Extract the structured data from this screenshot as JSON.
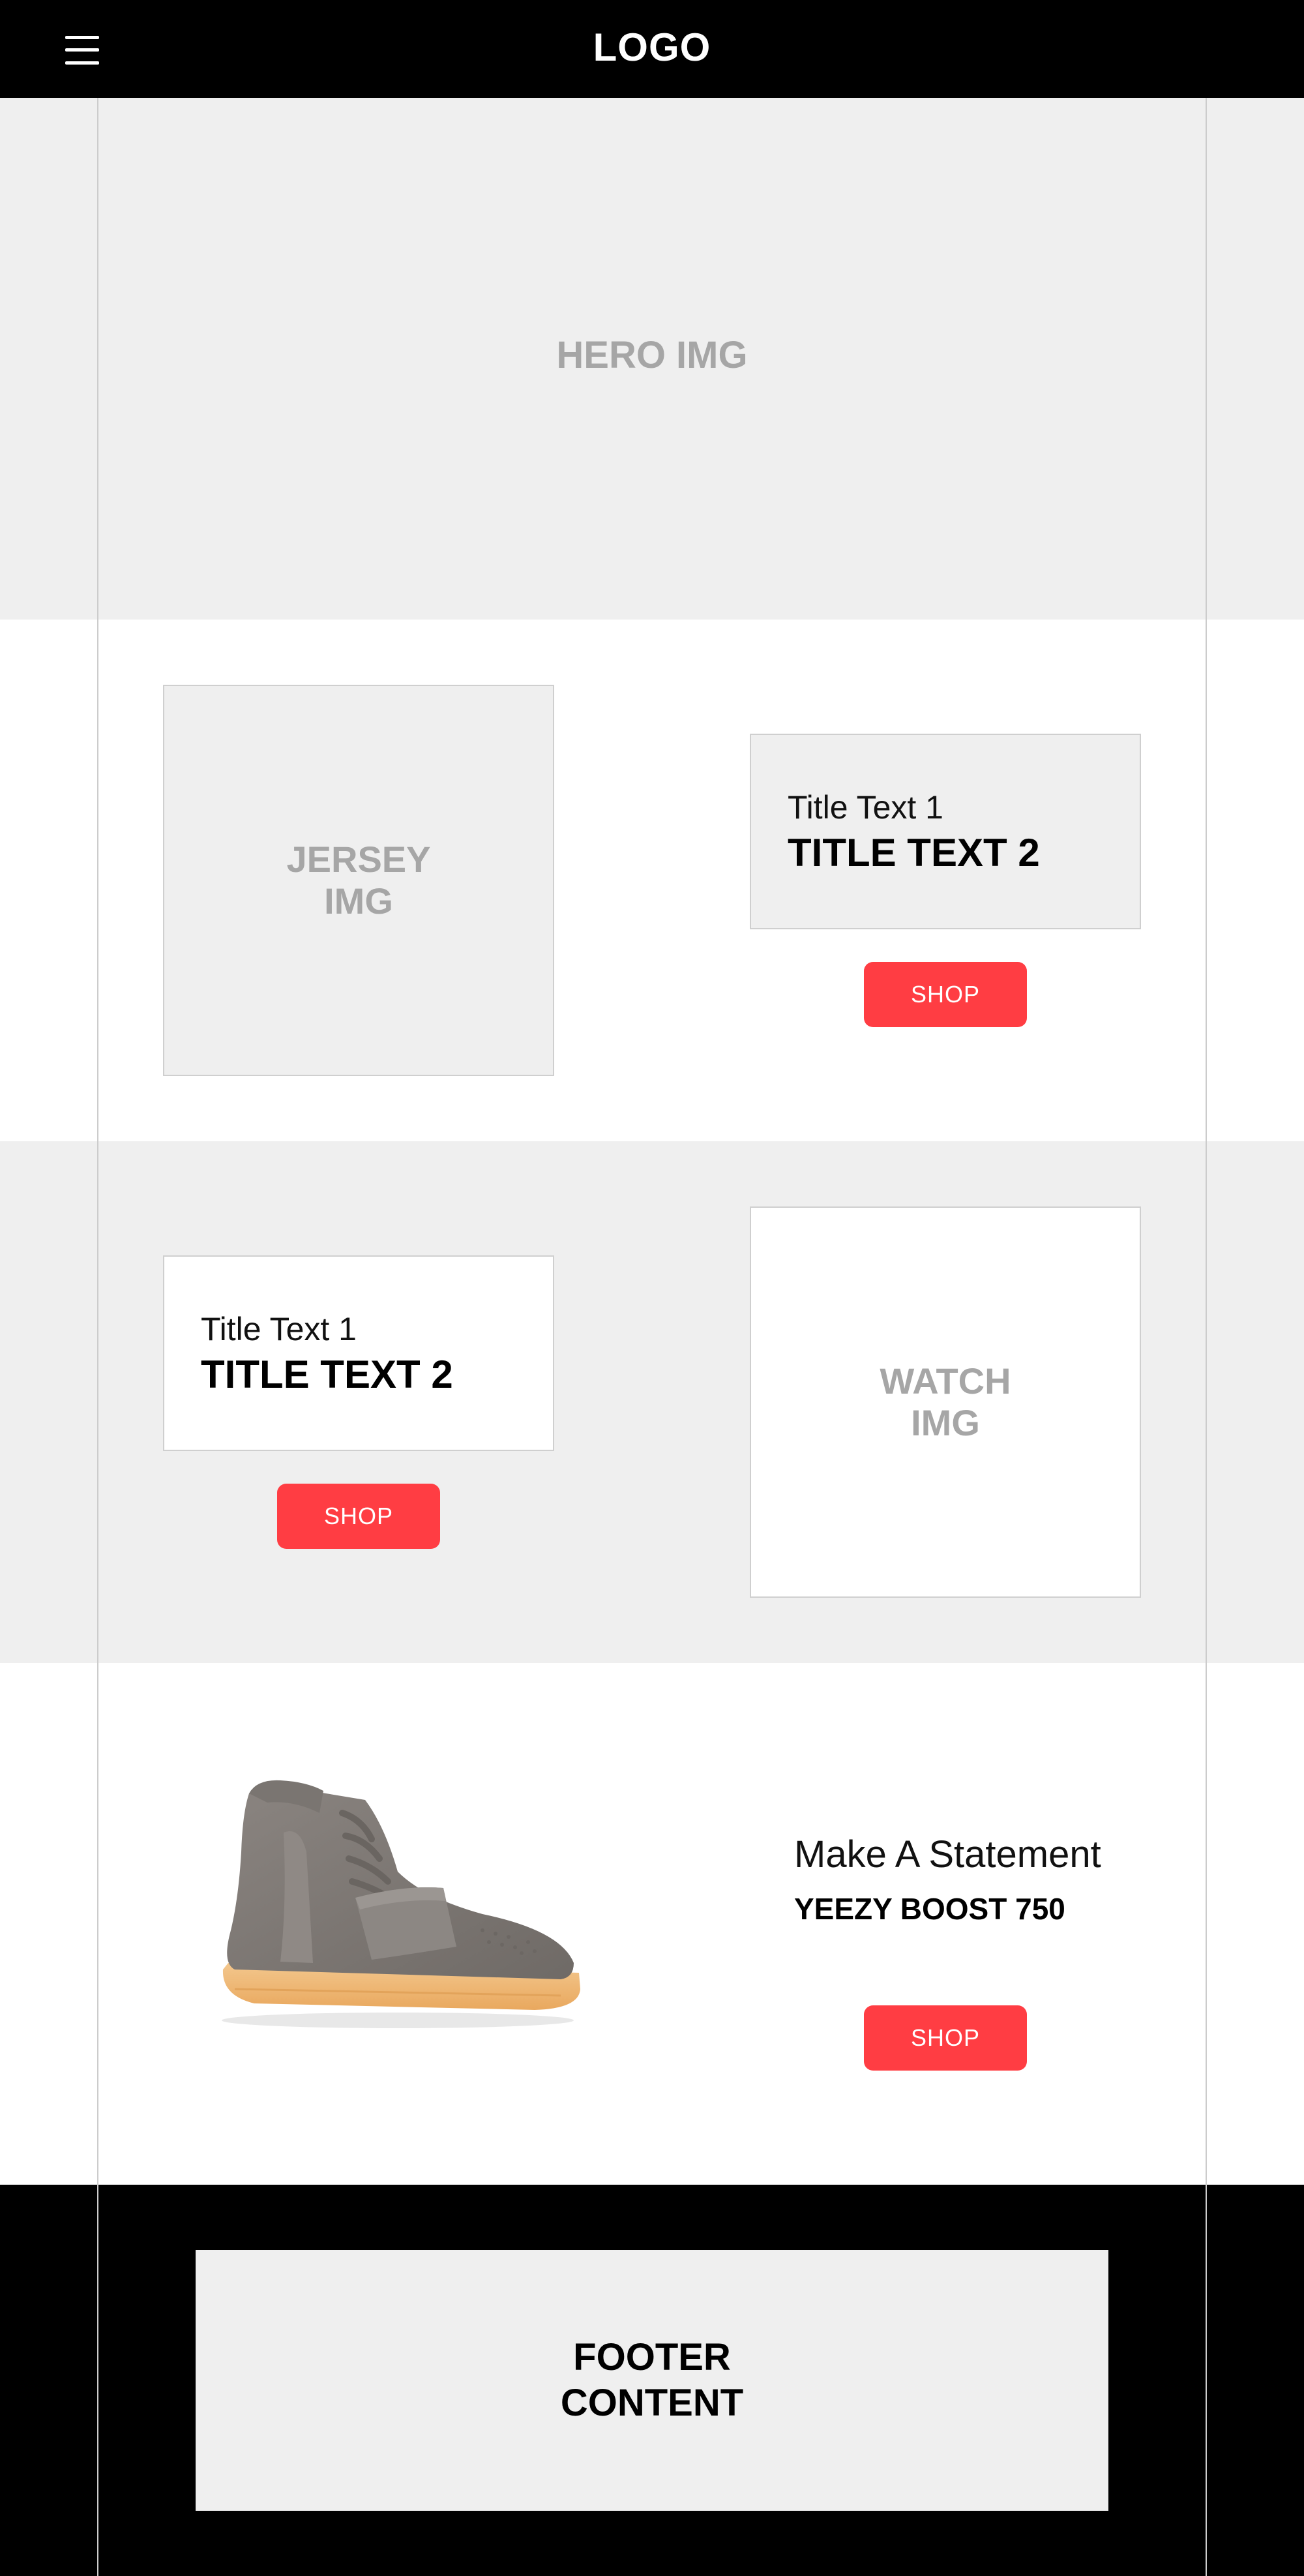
{
  "header": {
    "logo": "LOGO",
    "menu_icon": "hamburger-menu-icon"
  },
  "hero": {
    "label": "HERO IMG"
  },
  "section_1": {
    "image_label": "JERSEY IMG",
    "title_1": "Title Text 1",
    "title_2": "TITLE TEXT 2",
    "button_label": "SHOP"
  },
  "section_2": {
    "title_1": "Title Text 1",
    "title_2": "TITLE TEXT 2",
    "button_label": "SHOP",
    "image_label": "WATCH IMG"
  },
  "section_3": {
    "tagline": "Make A Statement",
    "product_name": "YEEZY BOOST 750",
    "button_label": "SHOP"
  },
  "footer": {
    "label": "FOOTER CONTENT"
  },
  "colors": {
    "accent": "#ff3d43",
    "header_bg": "#000000",
    "placeholder_bg": "#efefef",
    "placeholder_text": "#a6a6a6"
  }
}
